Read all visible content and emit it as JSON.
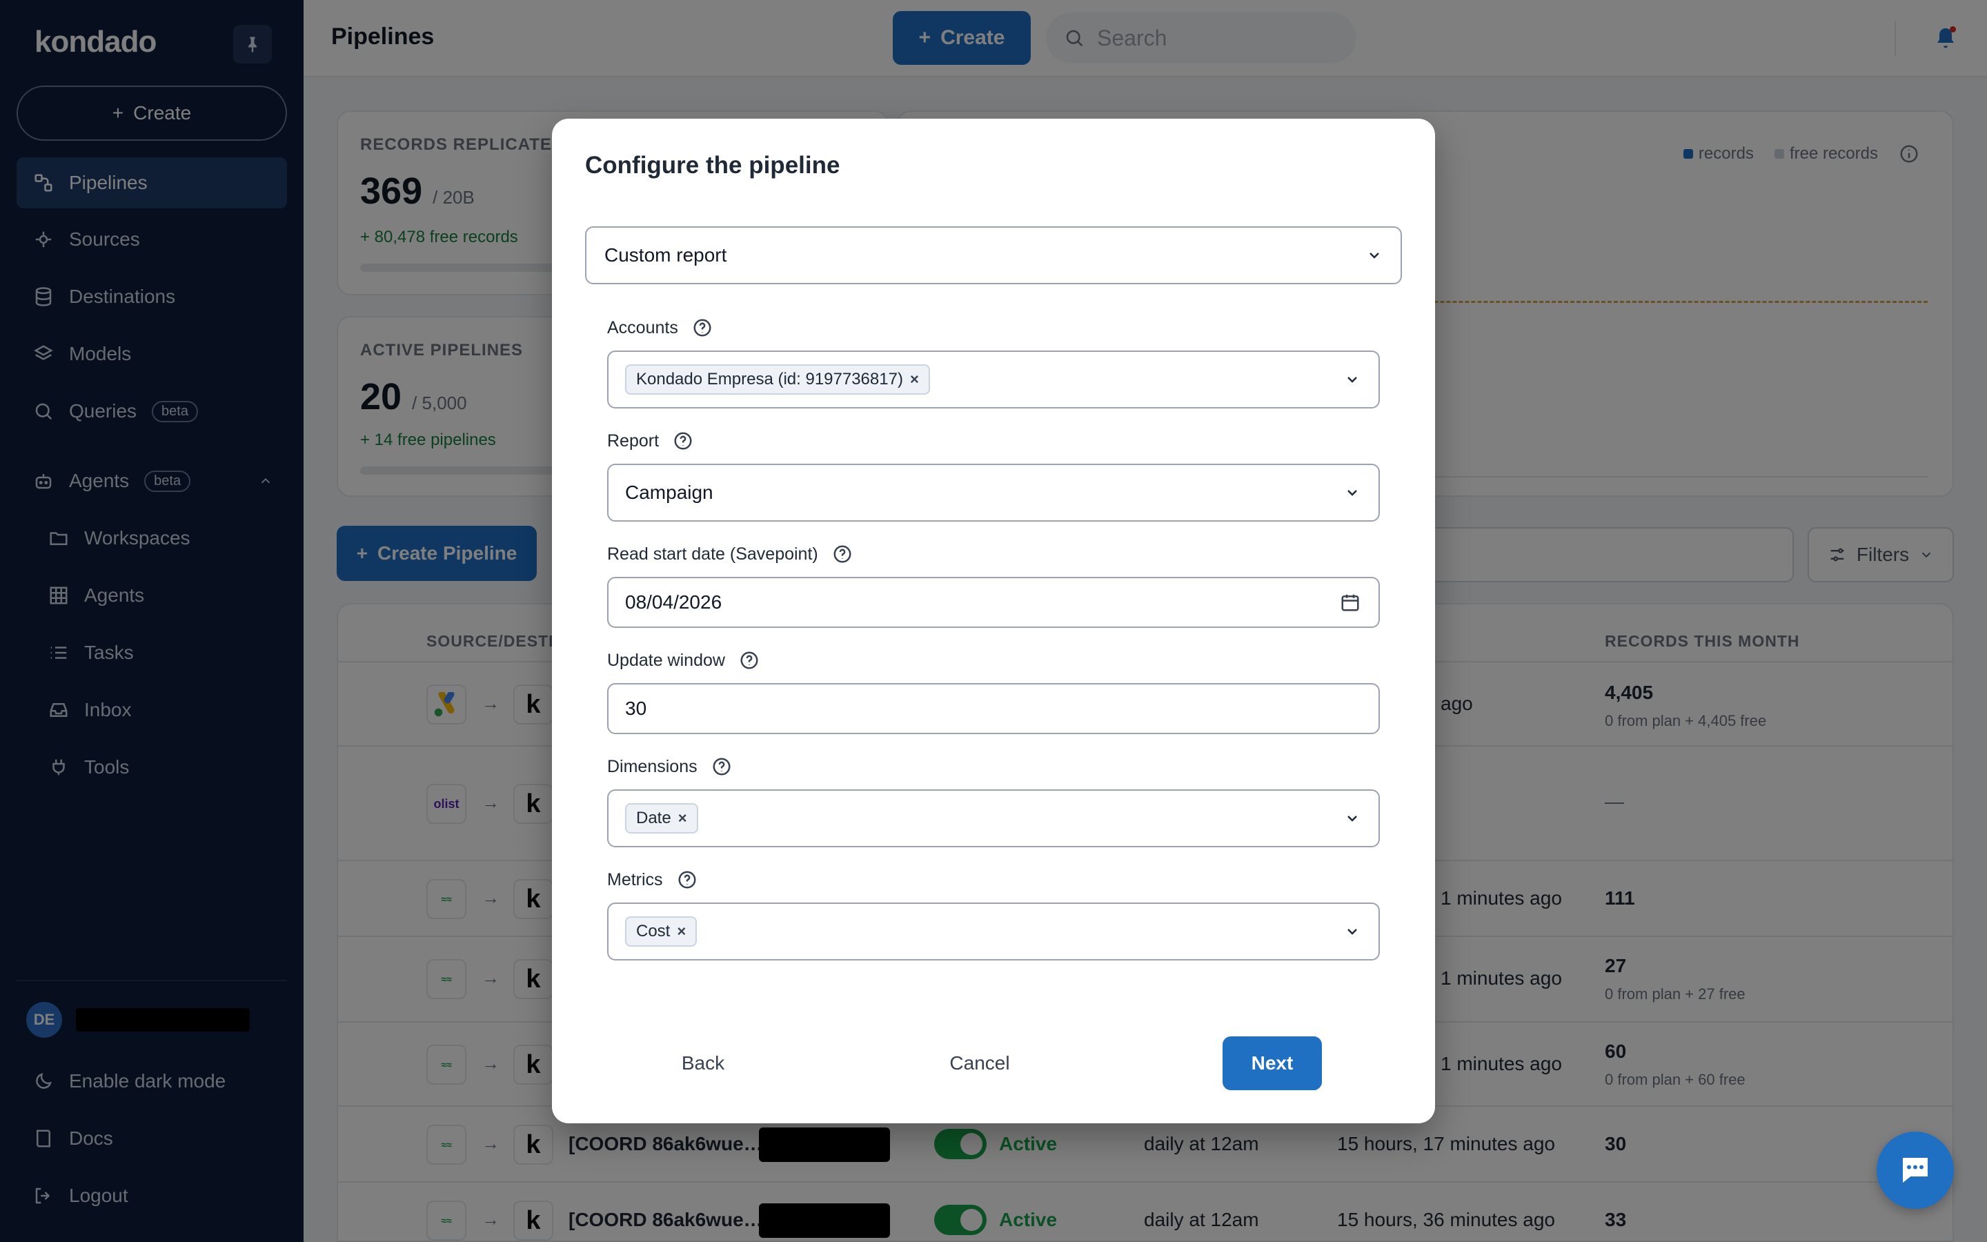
{
  "sidebar": {
    "logo": "kondado",
    "create_label": "Create",
    "items": [
      {
        "label": "Pipelines",
        "icon": "pipelines-icon"
      },
      {
        "label": "Sources",
        "icon": "sources-icon"
      },
      {
        "label": "Destinations",
        "icon": "database-icon"
      },
      {
        "label": "Models",
        "icon": "layers-icon"
      },
      {
        "label": "Queries",
        "icon": "search-icon",
        "badge": "beta"
      },
      {
        "label": "Agents",
        "icon": "robot-icon",
        "badge": "beta"
      },
      {
        "label": "Workspaces",
        "icon": "folder-icon"
      },
      {
        "label": "Agents",
        "icon": "grid-icon"
      },
      {
        "label": "Tasks",
        "icon": "list-icon"
      },
      {
        "label": "Inbox",
        "icon": "inbox-icon"
      },
      {
        "label": "Tools",
        "icon": "plug-icon"
      }
    ],
    "user_initials": "DE",
    "dark_mode_label": "Enable dark mode",
    "docs_label": "Docs",
    "logout_label": "Logout"
  },
  "topbar": {
    "title": "Pipelines",
    "create_label": "Create",
    "search_placeholder": "Search"
  },
  "kpis": {
    "records": {
      "label": "RECORDS REPLICATED",
      "value": "369",
      "limit": "/ 20B",
      "free": "+ 80,478 free records"
    },
    "pipelines": {
      "label": "ACTIVE PIPELINES",
      "value": "20",
      "limit": "/ 5,000",
      "free": "+ 14 free pipelines"
    },
    "legend": {
      "records": "records",
      "free_records": "free records"
    }
  },
  "toolbar": {
    "create_pipeline_label": "Create Pipeline",
    "filters_label": "Filters"
  },
  "table": {
    "headers": {
      "source": "SOURCE/DESTIN",
      "records": "RECORDS THIS MONTH"
    },
    "rows": [
      {
        "src": "google-ads",
        "last": "ago",
        "records": "4,405",
        "sub": "0 from plan + 4,405 free"
      },
      {
        "src": "olist",
        "last": "",
        "records": "—",
        "sub": ""
      },
      {
        "src": "coord",
        "last": "1 minutes ago",
        "records": "111",
        "sub": ""
      },
      {
        "src": "coord",
        "last": "1 minutes ago",
        "records": "27",
        "sub": "0 from plan + 27 free"
      },
      {
        "src": "coord",
        "last": "1 minutes ago",
        "records": "60",
        "sub": "0 from plan + 60 free"
      },
      {
        "src": "coord",
        "name": "[COORD 86ak6wue…",
        "status": "Active",
        "schedule": "daily at 12am",
        "last": "15 hours, 17 minutes ago",
        "records": "30",
        "sub": ""
      },
      {
        "src": "coord",
        "name": "[COORD 86ak6wue…",
        "status": "Active",
        "schedule": "daily at 12am",
        "last": "15 hours, 36 minutes ago",
        "records": "33",
        "sub": ""
      }
    ],
    "olist_text": "olist"
  },
  "modal": {
    "title": "Configure the pipeline",
    "report_type": "Custom report",
    "accounts": {
      "label": "Accounts",
      "chips": [
        "Kondado Empresa (id: 9197736817)"
      ]
    },
    "report": {
      "label": "Report",
      "value": "Campaign"
    },
    "start_date": {
      "label": "Read start date (Savepoint)",
      "value": "08/04/2026"
    },
    "update_window": {
      "label": "Update window",
      "value": "30"
    },
    "dimensions": {
      "label": "Dimensions",
      "chips": [
        "Date"
      ]
    },
    "metrics": {
      "label": "Metrics",
      "chips": [
        "Cost"
      ]
    },
    "buttons": {
      "back": "Back",
      "cancel": "Cancel",
      "next": "Next"
    }
  },
  "colors": {
    "primary": "#1f6fc2",
    "sidebar": "#0f1f3d",
    "success": "#16a34a"
  }
}
